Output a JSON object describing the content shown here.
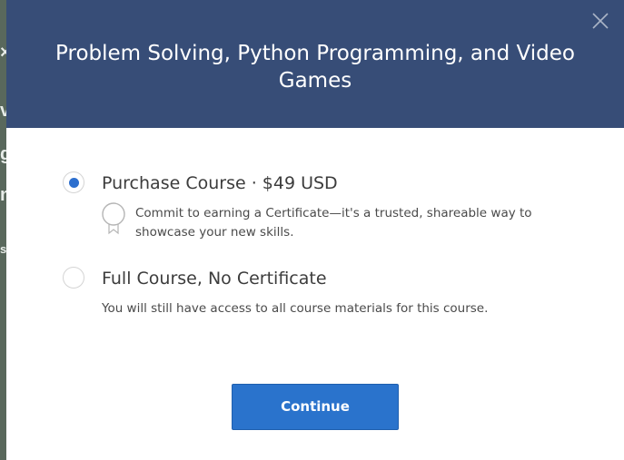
{
  "modal": {
    "title": "Problem Solving, Python Programming, and Video Games",
    "close_icon": "close-icon"
  },
  "options": [
    {
      "label": "Purchase Course · $49 USD",
      "selected": true,
      "description": "Commit to earning a Certificate—it's a trusted, shareable way to showcase your new skills.",
      "icon": "certificate-icon"
    },
    {
      "label": "Full Course, No Certificate",
      "selected": false,
      "description": "You will still have access to all course materials for this course."
    }
  ],
  "actions": {
    "continue_label": "Continue"
  },
  "colors": {
    "header_bg": "#374d77",
    "accent": "#2a73cc",
    "radio_selected": "#2d6fce"
  }
}
